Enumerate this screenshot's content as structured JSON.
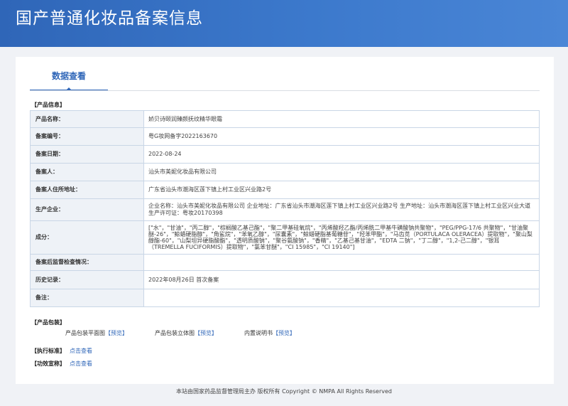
{
  "header": {
    "title": "国产普通化妆品备案信息"
  },
  "tab": {
    "label": "数据查看"
  },
  "product_info": {
    "section_label": "【产品信息】",
    "rows": [
      {
        "label": "产品名称：",
        "value": "娇贝诗颐润臻颜抚纹精华眼霜"
      },
      {
        "label": "备案编号：",
        "value": "粤G妆网备字2022163670"
      },
      {
        "label": "备案日期：",
        "value": "2022-08-24"
      },
      {
        "label": "备案人：",
        "value": "汕头市美妮化妆品有限公司"
      },
      {
        "label": "备案人住所地址：",
        "value": "广东省汕头市潮海区莲下镇上村工业区兴业路2号"
      },
      {
        "label": "生产企业：",
        "value": "企业名称：汕头市美妮化妆品有限公司 企业地址：广东省汕头市潮海区莲下镇上村工业区兴业路2号 生产地址：汕头市潮海区莲下镇上村工业区兴业大道 生产许可证：粤妆20170398"
      },
      {
        "label": "成分：",
        "value": "[\"水\"，\"甘油\"，\"丙二醇\"，\"棕榈酸乙基己酯\"，\"聚二甲基硅氧烷\"，\"丙烯酸羟乙酯/丙烯酰二甲基牛磺酸钠共聚物\"，\"PEG/PPG-17/6 共聚物\"，\"甘油聚醚-26\"，\"鲸蜡硬脂醇\"，\"角鲨烷\"，\"苯氧乙醇\"，\"尿囊素\"，\"鲸蜡硬脂基葡糖苷\"，\"羟苯甲酯\"，\"马齿苋（PORTULACA OLERACEA）提取物\"，\"聚山梨醇酯-60\"，\"山梨坦异硬脂酸酯\"，\"透明质酸钠\"，\"聚谷氨酸钠\"，\"香精\"，\"乙基己基甘油\"，\"EDTA 二钠\"，\"丁二醇\"，\"1,2-己二醇\"，\"银耳（TREMELLA FUCIFORMIS）提取物\"，\"氯苯甘醚\"，\"CI 15985\"，\"CI 19140\"]"
      },
      {
        "label": "备案后监督检查情况：",
        "value": ""
      },
      {
        "label": "历史记录：",
        "value": "2022年08月26日 首次备案"
      },
      {
        "label": "备注：",
        "value": ""
      }
    ]
  },
  "packaging": {
    "section_label": "【产品包装】",
    "items": [
      {
        "name": "产品包装平面图",
        "link": "【预览】"
      },
      {
        "name": "产品包装立体图",
        "link": "【预览】"
      },
      {
        "name": "内置说明书",
        "link": "【预览】"
      }
    ]
  },
  "standard": {
    "section_label": "【执行标准】",
    "link": "点击查看"
  },
  "efficacy": {
    "section_label": "【功效宣称】",
    "link": "点击查看"
  },
  "footer": {
    "text": "本站由国家药品监督管理局主办 版权所有 Copyright © NMPA All Rights Reserved"
  }
}
